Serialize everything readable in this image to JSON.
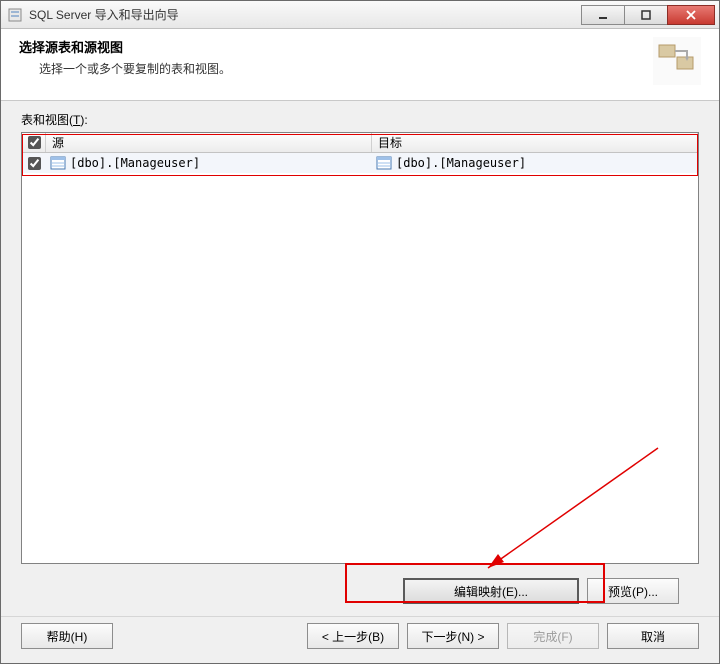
{
  "window": {
    "title": "SQL Server 导入和导出向导"
  },
  "header": {
    "title": "选择源表和源视图",
    "subtitle": "选择一个或多个要复制的表和视图。"
  },
  "tableCaption": {
    "prefix": "表和视图(",
    "hotkey": "T",
    "suffix": "):"
  },
  "columns": {
    "source": "源",
    "target": "目标"
  },
  "headerChecked": true,
  "rows": [
    {
      "checked": true,
      "source": "[dbo].[Manageuser]",
      "target": "[dbo].[Manageuser]"
    }
  ],
  "actions": {
    "editMapping": "编辑映射(E)...",
    "preview": "预览(P)..."
  },
  "footer": {
    "help": "帮助(H)",
    "back": "< 上一步(B)",
    "next": "下一步(N) >",
    "finish": "完成(F)",
    "cancel": "取消"
  }
}
